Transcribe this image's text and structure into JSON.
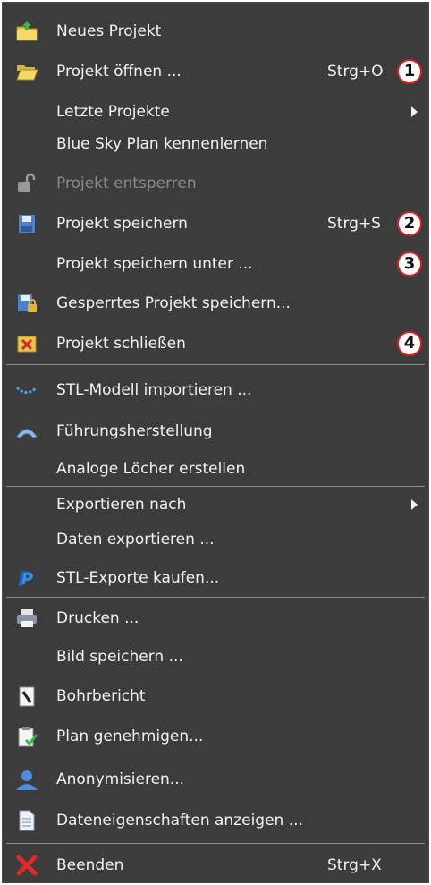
{
  "menu": {
    "items": [
      {
        "label": "Neues Projekt",
        "shortcut": "",
        "icon": "folder-new-icon"
      },
      {
        "label": "Projekt öffnen ...",
        "shortcut": "Strg+O",
        "icon": "folder-open-icon",
        "badge": "1"
      },
      {
        "label": "Letzte Projekte",
        "shortcut": "",
        "icon": "",
        "submenu": true
      },
      {
        "label": "Blue Sky Plan kennenlernen",
        "shortcut": "",
        "icon": ""
      },
      {
        "label": "Projekt entsperren",
        "shortcut": "",
        "icon": "unlock-icon",
        "disabled": true
      },
      {
        "label": "Projekt speichern",
        "shortcut": "Strg+S",
        "icon": "save-icon",
        "badge": "2"
      },
      {
        "label": "Projekt speichern unter ...",
        "shortcut": "",
        "icon": "",
        "badge": "3"
      },
      {
        "label": "Gesperrtes Projekt speichern...",
        "shortcut": "",
        "icon": "save-locked-icon"
      },
      {
        "label": "Projekt schließen",
        "shortcut": "",
        "icon": "close-project-icon",
        "badge": "4"
      },
      {
        "label": "STL-Modell importieren ...",
        "shortcut": "",
        "icon": "stl-import-icon"
      },
      {
        "label": "Führungsherstellung",
        "shortcut": "",
        "icon": "guide-icon"
      },
      {
        "label": "Analoge Löcher erstellen",
        "shortcut": "",
        "icon": ""
      },
      {
        "label": "Exportieren nach",
        "shortcut": "",
        "icon": "",
        "submenu": true
      },
      {
        "label": "Daten exportieren ...",
        "shortcut": "",
        "icon": ""
      },
      {
        "label": "STL-Exporte kaufen...",
        "shortcut": "",
        "icon": "paypal-icon"
      },
      {
        "label": "Drucken ...",
        "shortcut": "",
        "icon": "printer-icon"
      },
      {
        "label": "Bild speichern ...",
        "shortcut": "",
        "icon": ""
      },
      {
        "label": "Bohrbericht",
        "shortcut": "",
        "icon": "drill-report-icon"
      },
      {
        "label": "Plan genehmigen...",
        "shortcut": "",
        "icon": "approve-plan-icon"
      },
      {
        "label": "Anonymisieren...",
        "shortcut": "",
        "icon": "user-icon"
      },
      {
        "label": "Dateneigenschaften anzeigen ...",
        "shortcut": "",
        "icon": "document-icon"
      },
      {
        "label": "Beenden",
        "shortcut": "Strg+X",
        "icon": "exit-icon"
      }
    ]
  },
  "colors": {
    "menu_bg": "#3c3c3c",
    "text": "#f2f2f2",
    "disabled_text": "#8a8a8a",
    "badge_border": "#d91f1f"
  }
}
